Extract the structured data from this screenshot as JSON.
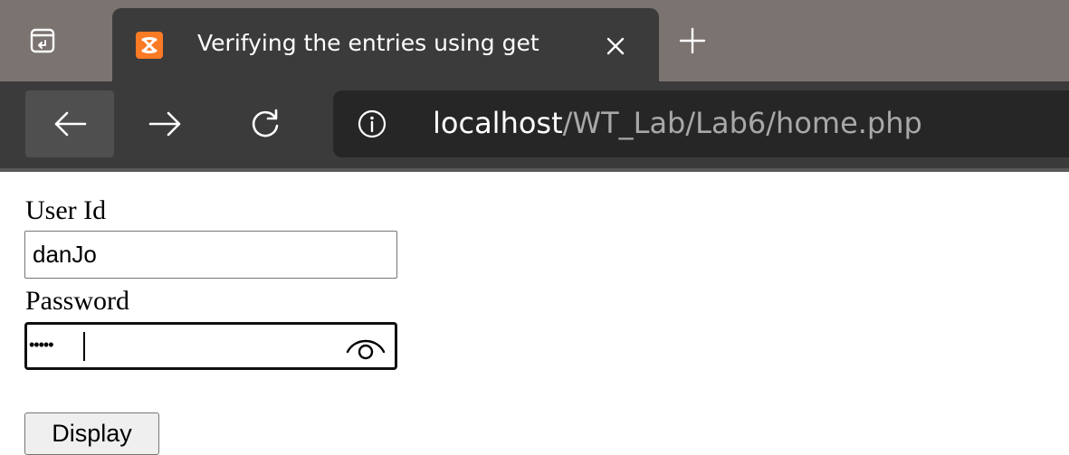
{
  "browser": {
    "tab": {
      "title": "Verifying the entries using get",
      "favicon_color": "#fb7a24"
    },
    "address_bar": {
      "host": "localhost",
      "path": "/WT_Lab/Lab6/home.php"
    },
    "icons": {
      "tab_actions": "tab-actions-icon",
      "favicon": "xampp-icon",
      "close": "close-icon",
      "new_tab": "plus-icon",
      "back": "arrow-left-icon",
      "forward": "arrow-right-icon",
      "reload": "reload-icon",
      "site_info": "info-icon"
    },
    "colors": {
      "tabstrip": "#7a7370",
      "toolbar": "#3b3b3b",
      "omnibox": "#262626"
    }
  },
  "form": {
    "user_id": {
      "label": "User Id",
      "value": "danJo"
    },
    "password": {
      "label": "Password",
      "masked_value": "•••••",
      "reveal_icon": "eye-icon"
    },
    "submit_label": "Display"
  }
}
